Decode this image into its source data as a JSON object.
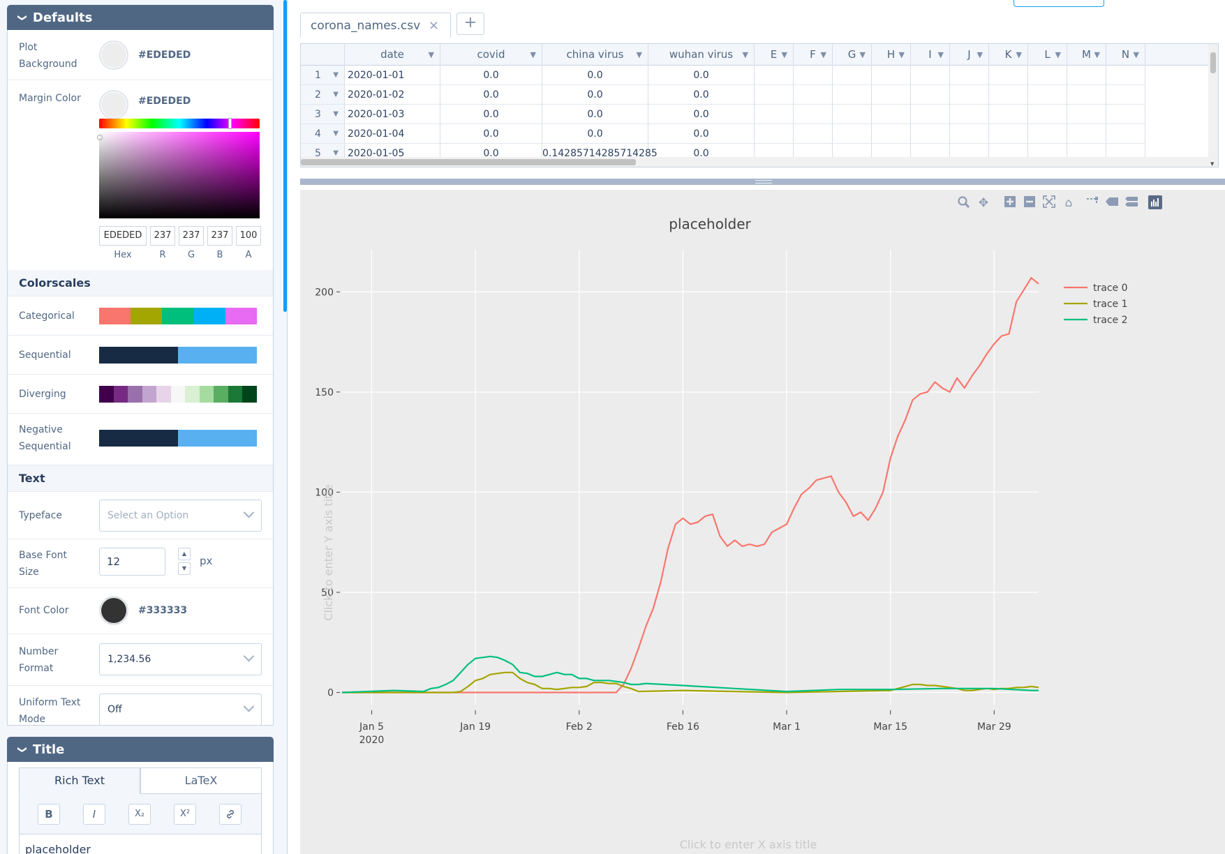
{
  "sidebar": {
    "defaults_fold": {
      "title": "Defaults"
    },
    "plot_background": {
      "label_line1": "Plot",
      "label_line2": "Background",
      "hex": "#EDEDED",
      "color": "#EDEDED"
    },
    "margin_color": {
      "label": "Margin Color",
      "hex": "#EDEDED",
      "color": "#EDEDED"
    },
    "picker": {
      "hex_value": "EDEDED",
      "r": "237",
      "g": "237",
      "b": "237",
      "a": "100",
      "labels": {
        "hex": "Hex",
        "r": "R",
        "g": "G",
        "b": "B",
        "a": "A"
      }
    },
    "colorscales_title": "Colorscales",
    "colorscales": [
      {
        "label": "Categorical",
        "colors": [
          "#F8766D",
          "#A3A500",
          "#00BF7D",
          "#00B0F6",
          "#E76BF3"
        ]
      },
      {
        "label": "Sequential",
        "colors": [
          "#172B45",
          "#59B0F0"
        ]
      },
      {
        "label": "Diverging",
        "colors": [
          "#40004B",
          "#762A83",
          "#9970AB",
          "#C2A5CF",
          "#E7D4E8",
          "#F7F7F7",
          "#D9F0D3",
          "#A6DBA0",
          "#5AAE61",
          "#1B7837",
          "#00441B"
        ]
      },
      {
        "label_line1": "Negative",
        "label_line2": "Sequential",
        "colors": [
          "#172B45",
          "#59B0F0"
        ]
      }
    ],
    "text_title": "Text",
    "typeface": {
      "label": "Typeface",
      "placeholder": "Select an Option"
    },
    "base_font": {
      "label_line1": "Base Font",
      "label_line2": "Size",
      "value": "12",
      "unit": "px"
    },
    "font_color": {
      "label": "Font Color",
      "hex": "#333333",
      "color": "#333333"
    },
    "number_format": {
      "label_line1": "Number",
      "label_line2": "Format",
      "value": "1,234.56"
    },
    "uniform_text": {
      "label_line1": "Uniform Text",
      "label_line2": "Mode",
      "value": "Off"
    },
    "title_fold": {
      "title": "Title"
    },
    "title_editor": {
      "tab_rich": "Rich Text",
      "tab_latex": "LaTeX",
      "buttons": {
        "bold": "B",
        "italic": "I",
        "sub": "X₂",
        "sup": "X²",
        "link": "link-icon"
      },
      "text": "placeholder"
    }
  },
  "file_tab": {
    "name": "corona_names.csv",
    "close": "×",
    "add": "+"
  },
  "grid": {
    "columns": [
      "date",
      "covid",
      "china virus",
      "wuhan virus",
      "E",
      "F",
      "G",
      "H",
      "I",
      "J",
      "K",
      "L",
      "M",
      "N"
    ],
    "rows": [
      {
        "n": "1",
        "date": "2020-01-01",
        "covid": "0.0",
        "china": "0.0",
        "wuhan": "0.0"
      },
      {
        "n": "2",
        "date": "2020-01-02",
        "covid": "0.0",
        "china": "0.0",
        "wuhan": "0.0"
      },
      {
        "n": "3",
        "date": "2020-01-03",
        "covid": "0.0",
        "china": "0.0",
        "wuhan": "0.0"
      },
      {
        "n": "4",
        "date": "2020-01-04",
        "covid": "0.0",
        "china": "0.0",
        "wuhan": "0.0"
      },
      {
        "n": "5",
        "date": "2020-01-05",
        "covid": "0.0",
        "china": "0.14285714285714285",
        "wuhan": "0.0"
      }
    ]
  },
  "chart_data": {
    "type": "line",
    "title": "placeholder",
    "xlabel_placeholder": "Click to enter X axis title",
    "ylabel_placeholder": "Click to enter Y axis title",
    "x_ticks": [
      {
        "label": "Jan 5",
        "sub": "2020",
        "date": "2020-01-05"
      },
      {
        "label": "Jan 19",
        "sub": "",
        "date": "2020-01-19"
      },
      {
        "label": "Feb 2",
        "sub": "",
        "date": "2020-02-02"
      },
      {
        "label": "Feb 16",
        "sub": "",
        "date": "2020-02-16"
      },
      {
        "label": "Mar 1",
        "sub": "",
        "date": "2020-03-01"
      },
      {
        "label": "Mar 15",
        "sub": "",
        "date": "2020-03-15"
      },
      {
        "label": "Mar 29",
        "sub": "",
        "date": "2020-03-29"
      }
    ],
    "y_ticks": [
      0,
      50,
      100,
      150,
      200
    ],
    "x_range": [
      "2020-01-01",
      "2020-04-04"
    ],
    "ylim": [
      -4,
      221
    ],
    "legend_position": "top-right",
    "grid": true,
    "series": [
      {
        "name": "trace 0",
        "color": "#F8766D",
        "x": [
          "2020-01-01",
          "2020-02-07",
          "2020-02-08",
          "2020-02-09",
          "2020-02-10",
          "2020-02-11",
          "2020-02-12",
          "2020-02-13",
          "2020-02-14",
          "2020-02-15",
          "2020-02-16",
          "2020-02-17",
          "2020-02-18",
          "2020-02-19",
          "2020-02-20",
          "2020-02-21",
          "2020-02-22",
          "2020-02-23",
          "2020-02-24",
          "2020-02-25",
          "2020-02-26",
          "2020-02-27",
          "2020-02-28",
          "2020-02-29",
          "2020-03-01",
          "2020-03-02",
          "2020-03-03",
          "2020-03-04",
          "2020-03-05",
          "2020-03-06",
          "2020-03-07",
          "2020-03-08",
          "2020-03-09",
          "2020-03-10",
          "2020-03-11",
          "2020-03-12",
          "2020-03-13",
          "2020-03-14",
          "2020-03-15",
          "2020-03-16",
          "2020-03-17",
          "2020-03-18",
          "2020-03-19",
          "2020-03-20",
          "2020-03-21",
          "2020-03-22",
          "2020-03-23",
          "2020-03-24",
          "2020-03-25",
          "2020-03-26",
          "2020-03-27",
          "2020-03-28",
          "2020-03-29",
          "2020-03-30",
          "2020-03-31",
          "2020-04-01",
          "2020-04-02",
          "2020-04-03",
          "2020-04-04"
        ],
        "y": [
          0,
          0,
          4,
          12,
          22,
          33,
          42,
          55,
          72,
          84,
          87,
          84,
          85,
          88,
          89,
          78,
          73,
          76,
          73,
          74,
          73,
          74,
          80,
          82,
          84,
          92,
          99,
          102,
          106,
          107,
          108,
          100,
          95,
          88,
          90,
          86,
          92,
          100,
          117,
          128,
          136,
          146,
          149,
          150,
          155,
          152,
          150,
          157,
          152,
          158,
          163,
          169,
          174,
          178,
          179,
          195,
          201,
          207,
          204
        ]
      },
      {
        "name": "trace 1",
        "color": "#A3A500",
        "x": [
          "2020-01-01",
          "2020-01-12",
          "2020-01-13",
          "2020-01-16",
          "2020-01-17",
          "2020-01-18",
          "2020-01-19",
          "2020-01-20",
          "2020-01-21",
          "2020-01-22",
          "2020-01-23",
          "2020-01-24",
          "2020-01-25",
          "2020-01-26",
          "2020-01-27",
          "2020-01-28",
          "2020-01-29",
          "2020-01-30",
          "2020-01-31",
          "2020-02-01",
          "2020-02-02",
          "2020-02-03",
          "2020-02-04",
          "2020-02-05",
          "2020-02-06",
          "2020-02-07",
          "2020-02-08",
          "2020-02-09",
          "2020-02-10",
          "2020-02-16",
          "2020-02-23",
          "2020-03-01",
          "2020-03-08",
          "2020-03-15",
          "2020-03-16",
          "2020-03-17",
          "2020-03-18",
          "2020-03-19",
          "2020-03-20",
          "2020-03-21",
          "2020-03-22",
          "2020-03-23",
          "2020-03-24",
          "2020-03-25",
          "2020-03-26",
          "2020-03-27",
          "2020-03-28",
          "2020-03-29",
          "2020-03-30",
          "2020-03-31",
          "2020-04-01",
          "2020-04-02",
          "2020-04-03",
          "2020-04-04"
        ],
        "y": [
          0,
          0,
          0,
          0,
          0.5,
          3,
          6,
          7,
          9,
          9.5,
          10,
          10,
          7,
          5,
          4,
          2,
          2,
          1.5,
          2,
          2.5,
          2.5,
          3,
          5,
          5,
          4.5,
          4.5,
          3,
          2,
          0.5,
          1,
          0.5,
          0,
          0.5,
          1,
          2,
          3,
          4,
          4,
          3.5,
          3.5,
          3,
          2.5,
          2,
          1,
          1,
          1.5,
          2,
          1.5,
          2,
          2,
          2.5,
          2.5,
          3,
          2.5
        ]
      },
      {
        "name": "trace 2",
        "color": "#00BF7D",
        "x": [
          "2020-01-01",
          "2020-01-08",
          "2020-01-12",
          "2020-01-13",
          "2020-01-14",
          "2020-01-15",
          "2020-01-16",
          "2020-01-17",
          "2020-01-18",
          "2020-01-19",
          "2020-01-20",
          "2020-01-21",
          "2020-01-22",
          "2020-01-23",
          "2020-01-24",
          "2020-01-25",
          "2020-01-26",
          "2020-01-27",
          "2020-01-28",
          "2020-01-29",
          "2020-01-30",
          "2020-01-31",
          "2020-02-01",
          "2020-02-02",
          "2020-02-03",
          "2020-02-04",
          "2020-02-05",
          "2020-02-06",
          "2020-02-07",
          "2020-02-08",
          "2020-02-09",
          "2020-02-10",
          "2020-02-11",
          "2020-02-16",
          "2020-02-23",
          "2020-03-01",
          "2020-03-08",
          "2020-03-15",
          "2020-03-22",
          "2020-03-29",
          "2020-04-03",
          "2020-04-04"
        ],
        "y": [
          0,
          1,
          0.5,
          2,
          2.5,
          4,
          6,
          10,
          14,
          17,
          17.5,
          18,
          17.5,
          16,
          14,
          10,
          9.5,
          8,
          8,
          9,
          10,
          9,
          9,
          7,
          7,
          6,
          6,
          6,
          5.5,
          5,
          4,
          4,
          4.5,
          3.5,
          2,
          0.5,
          1.5,
          1.5,
          2,
          2,
          1,
          1
        ]
      }
    ]
  }
}
